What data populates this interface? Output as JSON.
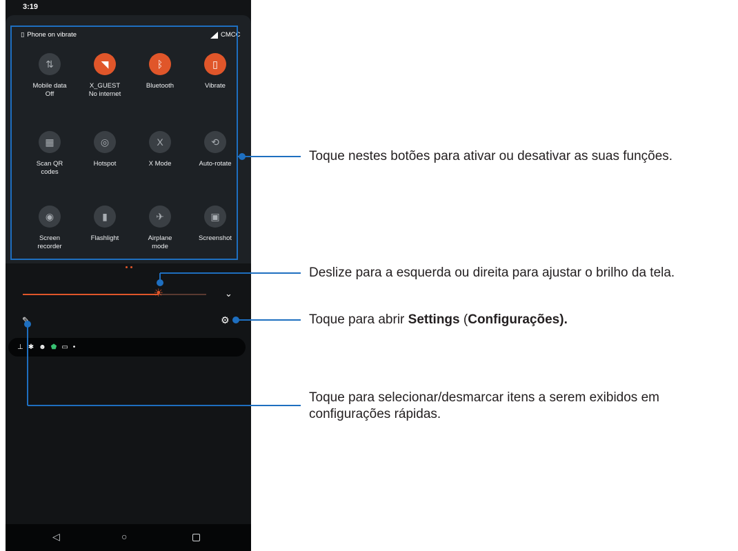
{
  "status_bar": {
    "time": "3:19"
  },
  "quick_panel": {
    "ringer_status": "Phone on vibrate",
    "carrier": "CMCC",
    "tiles": [
      {
        "label": "Mobile data\nOff",
        "icon": "mobile-data-icon",
        "glyph": "⇅",
        "active": false
      },
      {
        "label": "X_GUEST\nNo internet",
        "icon": "wifi-icon",
        "glyph": "◥",
        "active": true
      },
      {
        "label": "Bluetooth",
        "icon": "bluetooth-icon",
        "glyph": "ᛒ",
        "active": true
      },
      {
        "label": "Vibrate",
        "icon": "vibrate-icon",
        "glyph": "▯",
        "active": true
      },
      {
        "label": "Scan QR\ncodes",
        "icon": "qr-code-icon",
        "glyph": "▦",
        "active": false
      },
      {
        "label": "Hotspot",
        "icon": "hotspot-icon",
        "glyph": "◎",
        "active": false
      },
      {
        "label": "X Mode",
        "icon": "x-mode-icon",
        "glyph": "X",
        "active": false
      },
      {
        "label": "Auto-rotate",
        "icon": "auto-rotate-icon",
        "glyph": "⟲",
        "active": false
      },
      {
        "label": "Screen\nrecorder",
        "icon": "screen-recorder-icon",
        "glyph": "◉",
        "active": false
      },
      {
        "label": "Flashlight",
        "icon": "flashlight-icon",
        "glyph": "▮",
        "active": false
      },
      {
        "label": "Airplane\nmode",
        "icon": "airplane-icon",
        "glyph": "✈",
        "active": false
      },
      {
        "label": "Screenshot",
        "icon": "screenshot-icon",
        "glyph": "▣",
        "active": false
      }
    ],
    "brightness_level": 0.74
  },
  "colors": {
    "accent": "#e0562a",
    "annotation": "#1e6fc0"
  },
  "annotations": {
    "tiles": "Toque nestes botões para ativar ou desativar as suas funções.",
    "brightness": "Deslize para a esquerda ou direita para ajustar o brilho da tela.",
    "settings_pre": "Toque para abrir ",
    "settings_bold1": "Settings",
    "settings_mid": " (",
    "settings_bold2": "Configurações).",
    "edit": "Toque para selecionar/desmarcar itens a serem exibidos em configurações rápidas."
  }
}
